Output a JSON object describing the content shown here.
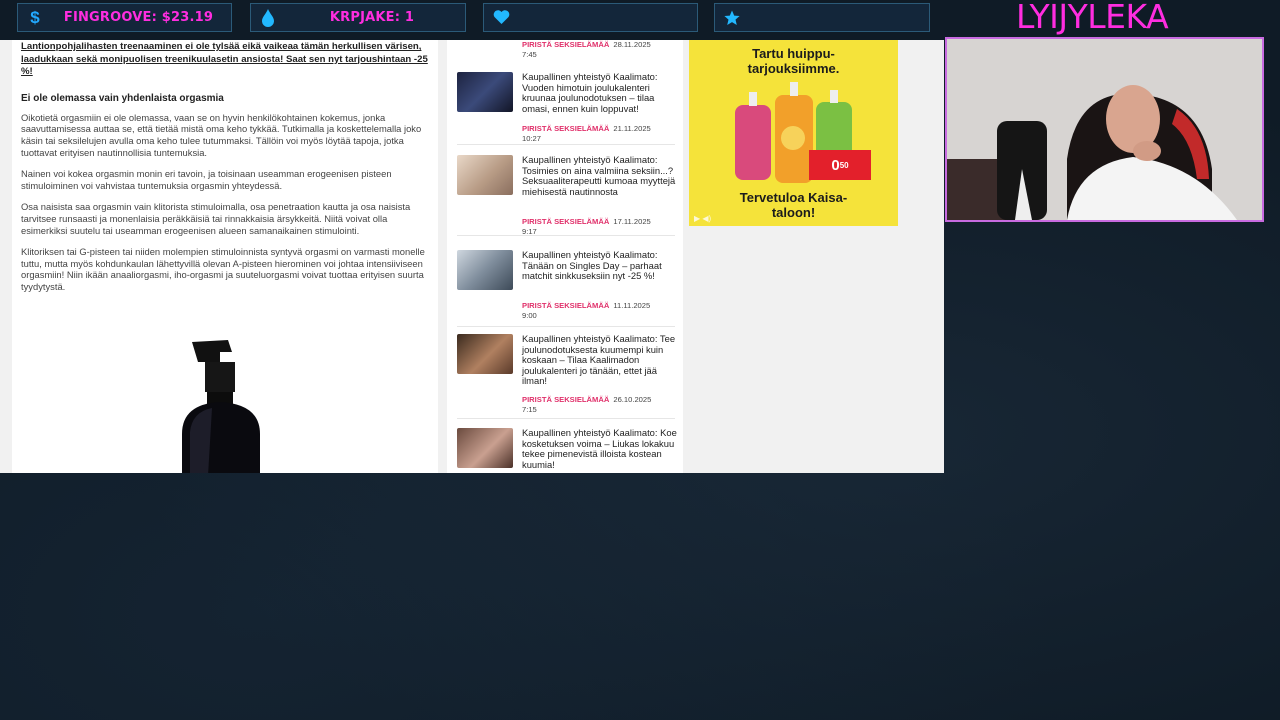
{
  "stats": {
    "fingroove": "FINGROOVE: $23.19",
    "krpjake": "KRPJAKE: 1",
    "heart_value": "",
    "star_value": ""
  },
  "streamer": {
    "name": "LYIJYLEKA"
  },
  "article": {
    "lead": "Lantionpohjalihasten treenaaminen ei ole tylsää eikä vaikeaa tämän herkullisen värisen, laadukkaan sekä monipuolisen treenikuulasetin ansiosta! Saat sen nyt tarjoushintaan -25 %!",
    "heading": "Ei ole olemassa vain yhdenlaista orgasmia",
    "paragraphs": [
      "Oikotietä orgasmiin ei ole olemassa, vaan se on hyvin henkilökohtainen kokemus, jonka saavuttamisessa auttaa se, että tietää mistä oma keho tykkää. Tutkimalla ja koskettelemalla joko käsin tai seksilelujen avulla oma keho tulee tutummaksi. Tällöin voi myös löytää tapoja, jotka tuottavat erityisen nautinnollisia tuntemuksia.",
      "Nainen voi kokea orgasmin monin eri tavoin, ja toisinaan useamman erogeenisen pisteen stimuloiminen voi vahvistaa tuntemuksia orgasmin yhteydessä.",
      "Osa naisista saa orgasmin vain klitorista stimuloimalla, osa penetraation kautta ja osa naisista tarvitsee runsaasti ja monenlaisia peräkkäisiä tai rinnakkaisia ärsykkeitä. Niitä voivat olla esimerkiksi suutelu tai useamman erogeenisen alueen samanaikainen stimulointi.",
      "Klitoriksen tai G-pisteen tai niiden molempien stimuloinnista syntyvä orgasmi on varmasti monelle tuttu, mutta myös kohdunkaulan lähettyvillä olevan A-pisteen hierominen voi johtaa intensiiviseen orgasmiin! Niin ikään anaaliorgasmi, iho-orgasmi ja suuteluorgasmi voivat tuottaa erityisen suurta tyydytystä."
    ]
  },
  "sidebar": {
    "top_meta": {
      "category": "PIRISTÄ SEKSIELÄMÄÄ",
      "date": "28.11.2025",
      "time": "7:45"
    },
    "posts": [
      {
        "title": "Kaupallinen yhteistyö Kaalimato: Vuoden himotuin joulukalenteri kruunaa joulunodotuksen – tilaa omasi, ennen kuin loppuvat!",
        "category": "PIRISTÄ SEKSIELÄMÄÄ",
        "date": "21.11.2025",
        "time": "10:27"
      },
      {
        "title": "Kaupallinen yhteistyö Kaalimato: Tosimies on aina valmiina seksiin...? Seksuaaliterapeutti kumoaa myyttejä miehisestä nautinnosta",
        "category": "PIRISTÄ SEKSIELÄMÄÄ",
        "date": "17.11.2025",
        "time": "9:17"
      },
      {
        "title": "Kaupallinen yhteistyö Kaalimato: Tänään on Singles Day – parhaat matchit sinkkuseksiin nyt -25 %!",
        "category": "PIRISTÄ SEKSIELÄMÄÄ",
        "date": "11.11.2025",
        "time": "9:00"
      },
      {
        "title": "Kaupallinen yhteistyö Kaalimato: Tee joulunodotuksesta kuumempi kuin koskaan – Tilaa Kaalimadon joulukalenteri jo tänään, ettet jää ilman!",
        "category": "PIRISTÄ SEKSIELÄMÄÄ",
        "date": "26.10.2025",
        "time": "7:15"
      },
      {
        "title": "Kaupallinen yhteistyö Kaalimato: Koe kosketuksen voima – Liukas lokakuu tekee pimenevistä illoista kostean kuumia!",
        "category": "",
        "date": "",
        "time": ""
      }
    ]
  },
  "ad": {
    "headline": "Tartu huippu-tarjouksiimme.",
    "price_main": "0",
    "price_cents": "50",
    "footer": "Tervetuloa Kaisa-taloon!"
  },
  "colors": {
    "accent_magenta": "#ff2de0",
    "category_pink": "#e0306a",
    "ad_yellow": "#f5e33a"
  },
  "icons": [
    "dollar-icon",
    "drop-icon",
    "heart-icon",
    "star-icon"
  ]
}
